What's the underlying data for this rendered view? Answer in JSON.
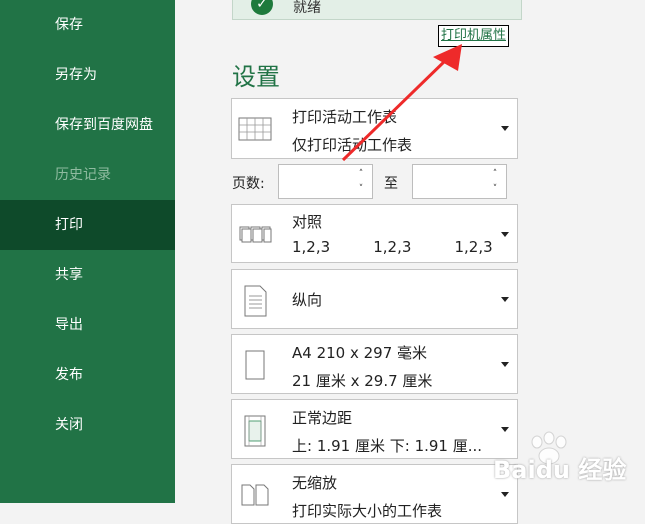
{
  "sidebar": {
    "items": [
      {
        "label": "保存",
        "state": "normal"
      },
      {
        "label": "另存为",
        "state": "normal"
      },
      {
        "label": "保存到百度网盘",
        "state": "normal"
      },
      {
        "label": "历史记录",
        "state": "disabled"
      },
      {
        "label": "打印",
        "state": "active"
      },
      {
        "label": "共享",
        "state": "normal"
      },
      {
        "label": "导出",
        "state": "normal"
      },
      {
        "label": "发布",
        "state": "normal"
      },
      {
        "label": "关闭",
        "state": "normal"
      }
    ]
  },
  "status": {
    "text": "就绪"
  },
  "printer_properties_link": "打印机属性",
  "settings": {
    "title": "设置",
    "print_what": {
      "line1": "打印活动工作表",
      "line2": "仅打印活动工作表"
    },
    "pages": {
      "label": "页数:",
      "to_label": "至",
      "from_value": "",
      "to_value": ""
    },
    "collate": {
      "line1": "对照",
      "line2": "1,2,3    1,2,3    1,2,3"
    },
    "orientation": {
      "line1": "纵向"
    },
    "paper": {
      "line1": "A4 210 x 297 毫米",
      "line2": "21 厘米 x 29.7 厘米"
    },
    "margins": {
      "line1": "正常边距",
      "line2": "上: 1.91 厘米 下: 1.91 厘..."
    },
    "scaling": {
      "line1": "无缩放",
      "line2": "打印实际大小的工作表"
    }
  },
  "watermark": {
    "text": "Baidu 经验"
  },
  "colors": {
    "sidebar_bg": "#217346",
    "active_bg": "#0e4a2a",
    "accent": "#217346",
    "arrow": "#ee2a2a"
  }
}
